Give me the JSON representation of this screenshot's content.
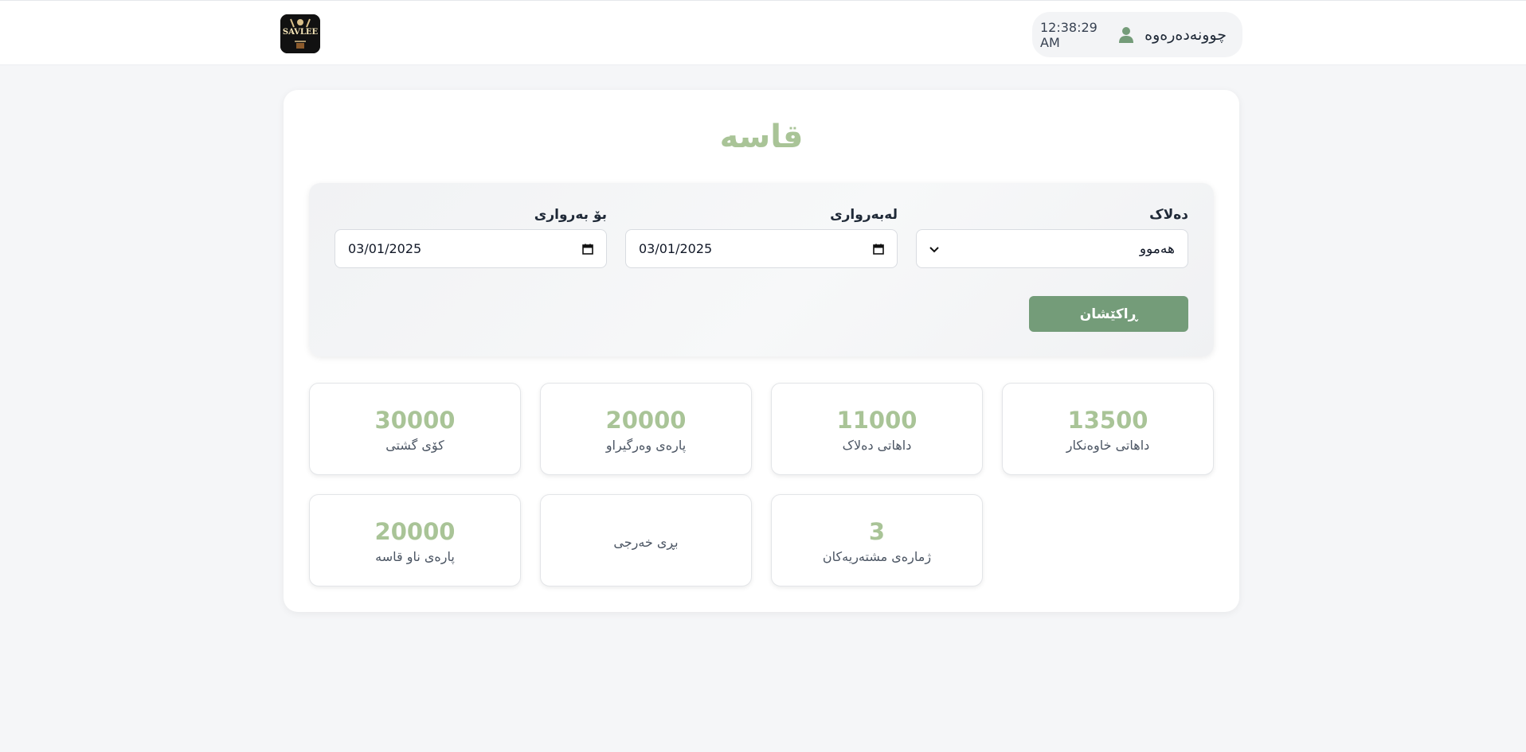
{
  "header": {
    "logo_text": "SAVLEE",
    "user_name": "چوونەدەرەوە",
    "time": "12:38:29 AM"
  },
  "page": {
    "title": "قاسە"
  },
  "filters": {
    "barber_label": "دەلاک",
    "barber_value": "هەموو",
    "from_label": "لەبەرواری",
    "from_value": "03/01/2025",
    "to_label": "بۆ بەرواری",
    "to_value": "03/01/2025",
    "search_label": "ڕاکێشان"
  },
  "stats": [
    {
      "value": "13500",
      "label": "داهاتی خاوەنکار"
    },
    {
      "value": "11000",
      "label": "داهاتی دەلاک"
    },
    {
      "value": "20000",
      "label": "پارەی وەرگیراو"
    },
    {
      "value": "30000",
      "label": "کۆی گشتی"
    },
    {
      "value": "3",
      "label": "ژمارەی مشتەریەکان"
    },
    {
      "value": "",
      "label": "بڕی خەرجی"
    },
    {
      "value": "20000",
      "label": "پارەی ناو قاسە"
    }
  ],
  "colors": {
    "accent": "#749c79",
    "value_green": "#a9c497"
  }
}
